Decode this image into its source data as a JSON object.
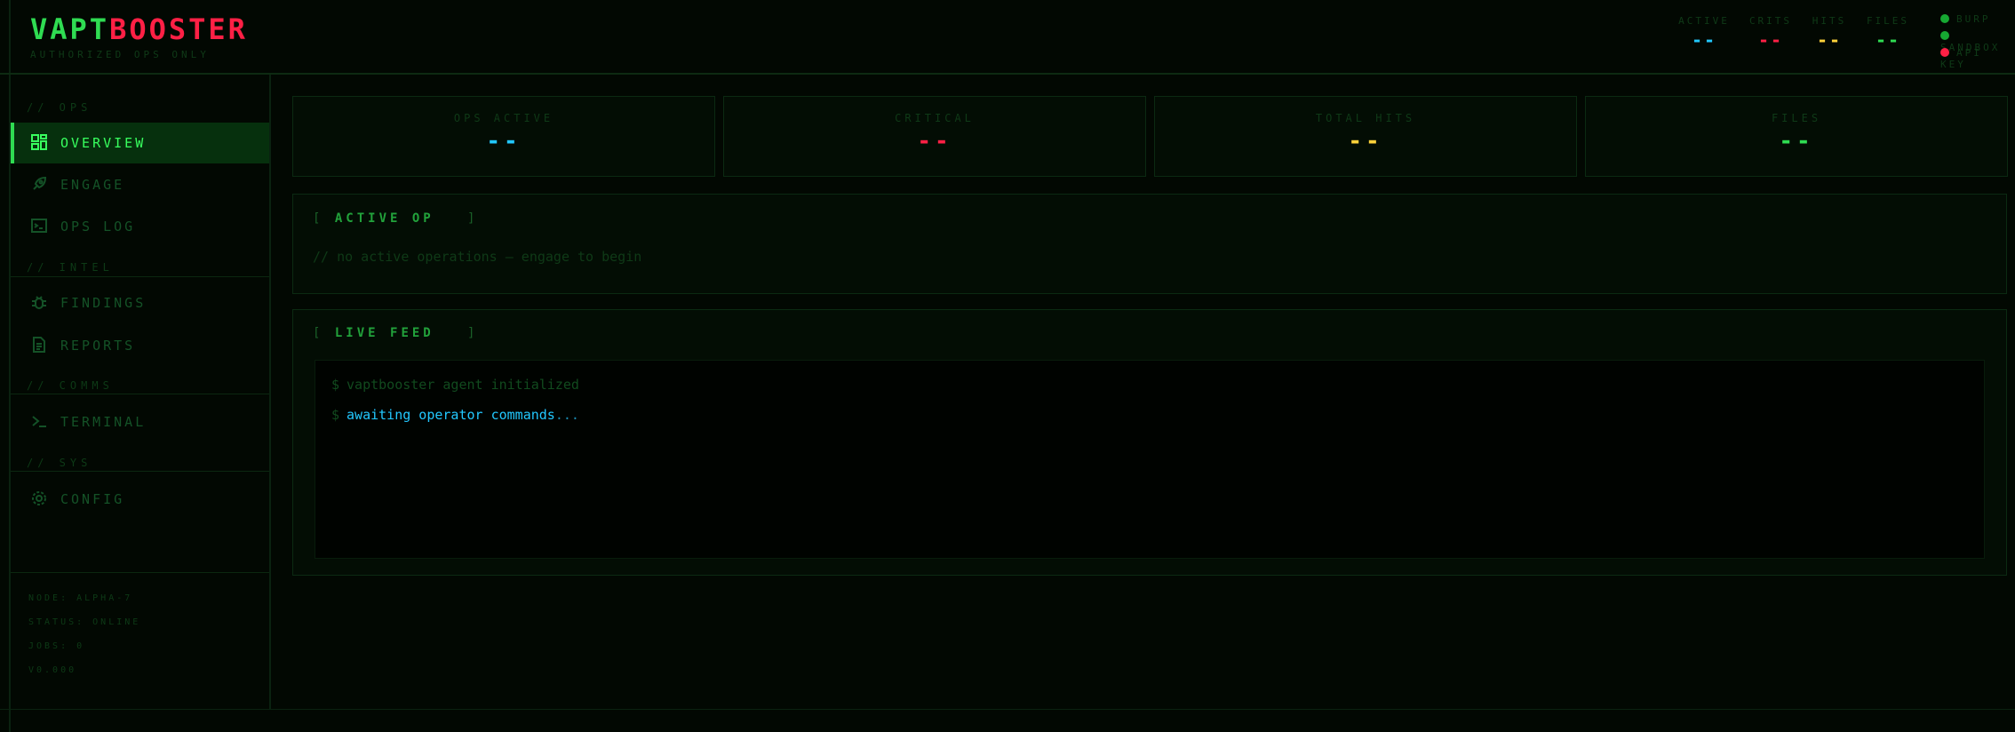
{
  "header": {
    "logo_part1": "VAPT",
    "logo_part2": "BOOSTER",
    "tagline": "AUTHORIZED OPS ONLY",
    "stats": [
      {
        "label": "ACTIVE",
        "value": "--",
        "color": "#22c8ff"
      },
      {
        "label": "CRITS",
        "value": "--",
        "color": "#ff2045"
      },
      {
        "label": "HITS",
        "value": "--",
        "color": "#ffd23a"
      },
      {
        "label": "FILES",
        "value": "--",
        "color": "#2fdc52"
      }
    ],
    "services": [
      {
        "label": "BURP",
        "color": "#16a832"
      },
      {
        "label": "SANDBOX",
        "color": "#16a832"
      },
      {
        "label": "API KEY",
        "color": "#ff2045"
      }
    ]
  },
  "sidebar": {
    "sections": {
      "ops": "// OPS",
      "intel": "// INTEL",
      "comms": "// COMMS",
      "sys": "// SYS"
    },
    "items": [
      {
        "label": "OVERVIEW",
        "icon": "dashboard-icon"
      },
      {
        "label": "ENGAGE",
        "icon": "rocket-icon"
      },
      {
        "label": "OPS LOG",
        "icon": "terminal-box-icon"
      },
      {
        "label": "FINDINGS",
        "icon": "bug-icon"
      },
      {
        "label": "REPORTS",
        "icon": "document-icon"
      },
      {
        "label": "TERMINAL",
        "icon": "prompt-icon"
      },
      {
        "label": "CONFIG",
        "icon": "gear-icon"
      }
    ],
    "meta": {
      "node": "NODE: ALPHA-7",
      "status": "STATUS: ONLINE",
      "jobs": "JOBS: 0",
      "version": "V0.000"
    }
  },
  "cards": [
    {
      "label": "OPS ACTIVE",
      "value": "--",
      "color": "#22c8ff"
    },
    {
      "label": "CRITICAL",
      "value": "--",
      "color": "#ff2045"
    },
    {
      "label": "TOTAL HITS",
      "value": "--",
      "color": "#ffd23a"
    },
    {
      "label": "FILES",
      "value": "--",
      "color": "#2fdc52"
    }
  ],
  "active_op": {
    "title_open": "[",
    "title": "ACTIVE OP",
    "title_close": "]",
    "empty": "// no active operations — engage to begin"
  },
  "live_feed": {
    "title_open": "[",
    "title": "LIVE FEED",
    "title_close": "]",
    "prompt": "$",
    "line1": "vaptbooster agent initialized",
    "line2": "awaiting operator commands",
    "line2_suffix": "..."
  }
}
